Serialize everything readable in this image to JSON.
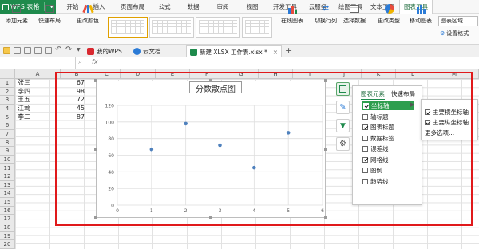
{
  "app": {
    "name": "WPS 表格"
  },
  "menu": [
    "开始",
    "插入",
    "页面布局",
    "公式",
    "数据",
    "审阅",
    "视图",
    "开发工具",
    "云服务",
    "绘图工具",
    "文本工具",
    "图表工具"
  ],
  "ribbon": {
    "add_element": "添加元素",
    "quick_layout": "快速布局",
    "change_color": "更改颜色",
    "online_chart": "在线图表",
    "switch_row_col": "切换行列",
    "select_data": "选择数据",
    "change_type": "更改类型",
    "move_chart": "移动图表",
    "chart_area": "图表区域",
    "format": "设置格式"
  },
  "tabs": {
    "my_wps": "我的WPS",
    "cloud": "云文档",
    "file": "新建 XLSX 工作表.xlsx *"
  },
  "formula": {
    "fx": "fx"
  },
  "columns": [
    "A",
    "B",
    "C",
    "D",
    "E",
    "F",
    "G",
    "H",
    "I",
    "J",
    "K",
    "L",
    "M"
  ],
  "rows": [
    "1",
    "2",
    "3",
    "4",
    "5",
    "6",
    "7",
    "8",
    "9",
    "10",
    "11",
    "12",
    "13",
    "14",
    "15",
    "16",
    "17",
    "18",
    "19",
    "20"
  ],
  "cells": [
    {
      "name": "张三",
      "score": "67"
    },
    {
      "name": "李四",
      "score": "98"
    },
    {
      "name": "王五",
      "score": "72"
    },
    {
      "name": "江莺",
      "score": "45"
    },
    {
      "name": "李二",
      "score": "87"
    }
  ],
  "chart_data": {
    "type": "scatter",
    "title": "分数散点图",
    "x": [
      1,
      2,
      3,
      4,
      5
    ],
    "y": [
      67,
      98,
      72,
      45,
      87
    ],
    "xlim": [
      0,
      6
    ],
    "ylim": [
      0,
      120
    ],
    "xticks": [
      0,
      1,
      2,
      3,
      4,
      5,
      6
    ],
    "yticks": [
      0,
      20,
      40,
      60,
      80,
      100,
      120
    ],
    "grid": true,
    "color": "#4f81bd"
  },
  "panel": {
    "tab_elements": "图表元素",
    "tab_layout": "快速布局",
    "items": [
      {
        "label": "坐标轴",
        "checked": true
      },
      {
        "label": "轴标题",
        "checked": false
      },
      {
        "label": "图表标题",
        "checked": true
      },
      {
        "label": "数据标签",
        "checked": false
      },
      {
        "label": "误差线",
        "checked": false
      },
      {
        "label": "网格线",
        "checked": true
      },
      {
        "label": "图例",
        "checked": false
      },
      {
        "label": "趋势线",
        "checked": false
      }
    ],
    "submenu": [
      {
        "label": "主要横坐标轴",
        "checked": true
      },
      {
        "label": "主要纵坐标轴",
        "checked": true
      }
    ],
    "more": "更多选项..."
  },
  "colors": {
    "brand": "#1e8a4c",
    "annotation": "#e0191b",
    "series": "#4f81bd"
  }
}
